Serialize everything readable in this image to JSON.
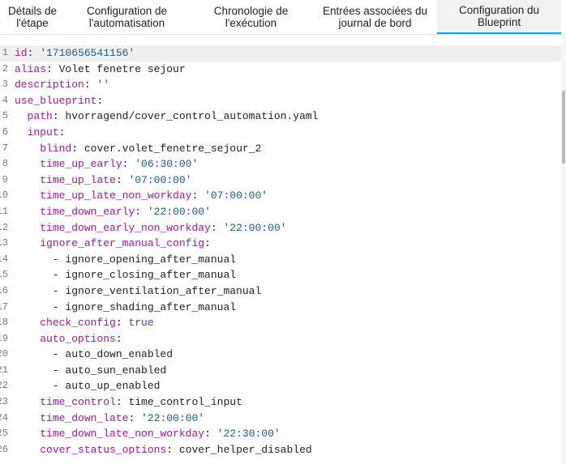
{
  "tabs": [
    {
      "label": "Détails de\nl'étape",
      "active": false
    },
    {
      "label": "Configuration de\nl'automatisation",
      "active": false
    },
    {
      "label": "Chronologie de\nl'exécution",
      "active": false
    },
    {
      "label": "Entrées associées du\njournal de bord",
      "active": false
    },
    {
      "label": "Configuration du\nBlueprint",
      "active": true
    }
  ],
  "editor": {
    "lines": [
      {
        "num": "1",
        "parts": [
          [
            "k",
            "id"
          ],
          [
            "p",
            ": "
          ],
          [
            "s",
            "'1710656541156'"
          ]
        ]
      },
      {
        "num": "2",
        "parts": [
          [
            "k",
            "alias"
          ],
          [
            "p",
            ": Volet fenetre sejour"
          ]
        ]
      },
      {
        "num": "3",
        "parts": [
          [
            "k",
            "description"
          ],
          [
            "p",
            ": "
          ],
          [
            "s",
            "''"
          ]
        ]
      },
      {
        "num": "4",
        "parts": [
          [
            "k",
            "use_blueprint"
          ],
          [
            "p",
            ":"
          ]
        ]
      },
      {
        "num": "5",
        "parts": [
          [
            "p",
            "  "
          ],
          [
            "k",
            "path"
          ],
          [
            "p",
            ": hvorragend/cover_control_automation.yaml"
          ]
        ]
      },
      {
        "num": "6",
        "parts": [
          [
            "p",
            "  "
          ],
          [
            "k",
            "input"
          ],
          [
            "p",
            ":"
          ]
        ]
      },
      {
        "num": "7",
        "parts": [
          [
            "p",
            "    "
          ],
          [
            "k",
            "blind"
          ],
          [
            "p",
            ": cover.volet_fenetre_sejour_2"
          ]
        ]
      },
      {
        "num": "8",
        "parts": [
          [
            "p",
            "    "
          ],
          [
            "k",
            "time_up_early"
          ],
          [
            "p",
            ": "
          ],
          [
            "s",
            "'06:30:00'"
          ]
        ]
      },
      {
        "num": "9",
        "parts": [
          [
            "p",
            "    "
          ],
          [
            "k",
            "time_up_late"
          ],
          [
            "p",
            ": "
          ],
          [
            "s",
            "'07:00:00'"
          ]
        ]
      },
      {
        "num": "10",
        "parts": [
          [
            "p",
            "    "
          ],
          [
            "k",
            "time_up_late_non_workday"
          ],
          [
            "p",
            ": "
          ],
          [
            "s",
            "'07:00:00'"
          ]
        ]
      },
      {
        "num": "11",
        "parts": [
          [
            "p",
            "    "
          ],
          [
            "k",
            "time_down_early"
          ],
          [
            "p",
            ": "
          ],
          [
            "s",
            "'22:00:00'"
          ]
        ]
      },
      {
        "num": "12",
        "parts": [
          [
            "p",
            "    "
          ],
          [
            "k",
            "time_down_early_non_workday"
          ],
          [
            "p",
            ": "
          ],
          [
            "s",
            "'22:00:00'"
          ]
        ]
      },
      {
        "num": "13",
        "parts": [
          [
            "p",
            "    "
          ],
          [
            "k",
            "ignore_after_manual_config"
          ],
          [
            "p",
            ":"
          ]
        ]
      },
      {
        "num": "14",
        "parts": [
          [
            "p",
            "      - ignore_opening_after_manual"
          ]
        ]
      },
      {
        "num": "15",
        "parts": [
          [
            "p",
            "      - ignore_closing_after_manual"
          ]
        ]
      },
      {
        "num": "16",
        "parts": [
          [
            "p",
            "      - ignore_ventilation_after_manual"
          ]
        ]
      },
      {
        "num": "17",
        "parts": [
          [
            "p",
            "      - ignore_shading_after_manual"
          ]
        ]
      },
      {
        "num": "18",
        "parts": [
          [
            "p",
            "    "
          ],
          [
            "k",
            "check_config"
          ],
          [
            "p",
            ": "
          ],
          [
            "b",
            "true"
          ]
        ]
      },
      {
        "num": "19",
        "parts": [
          [
            "p",
            "    "
          ],
          [
            "k",
            "auto_options"
          ],
          [
            "p",
            ":"
          ]
        ]
      },
      {
        "num": "20",
        "parts": [
          [
            "p",
            "      - auto_down_enabled"
          ]
        ]
      },
      {
        "num": "21",
        "parts": [
          [
            "p",
            "      - auto_sun_enabled"
          ]
        ]
      },
      {
        "num": "22",
        "parts": [
          [
            "p",
            "      - auto_up_enabled"
          ]
        ]
      },
      {
        "num": "23",
        "parts": [
          [
            "p",
            "    "
          ],
          [
            "k",
            "time_control"
          ],
          [
            "p",
            ": time_control_input"
          ]
        ]
      },
      {
        "num": "24",
        "parts": [
          [
            "p",
            "    "
          ],
          [
            "k",
            "time_down_late"
          ],
          [
            "p",
            ": "
          ],
          [
            "s",
            "'22:00:00'"
          ]
        ]
      },
      {
        "num": "25",
        "parts": [
          [
            "p",
            "    "
          ],
          [
            "k",
            "time_down_late_non_workday"
          ],
          [
            "p",
            ": "
          ],
          [
            "s",
            "'22:30:00'"
          ]
        ]
      },
      {
        "num": "26",
        "parts": [
          [
            "p",
            "    "
          ],
          [
            "k",
            "cover_status_options"
          ],
          [
            "p",
            ": cover_helper_disabled"
          ]
        ]
      }
    ]
  }
}
